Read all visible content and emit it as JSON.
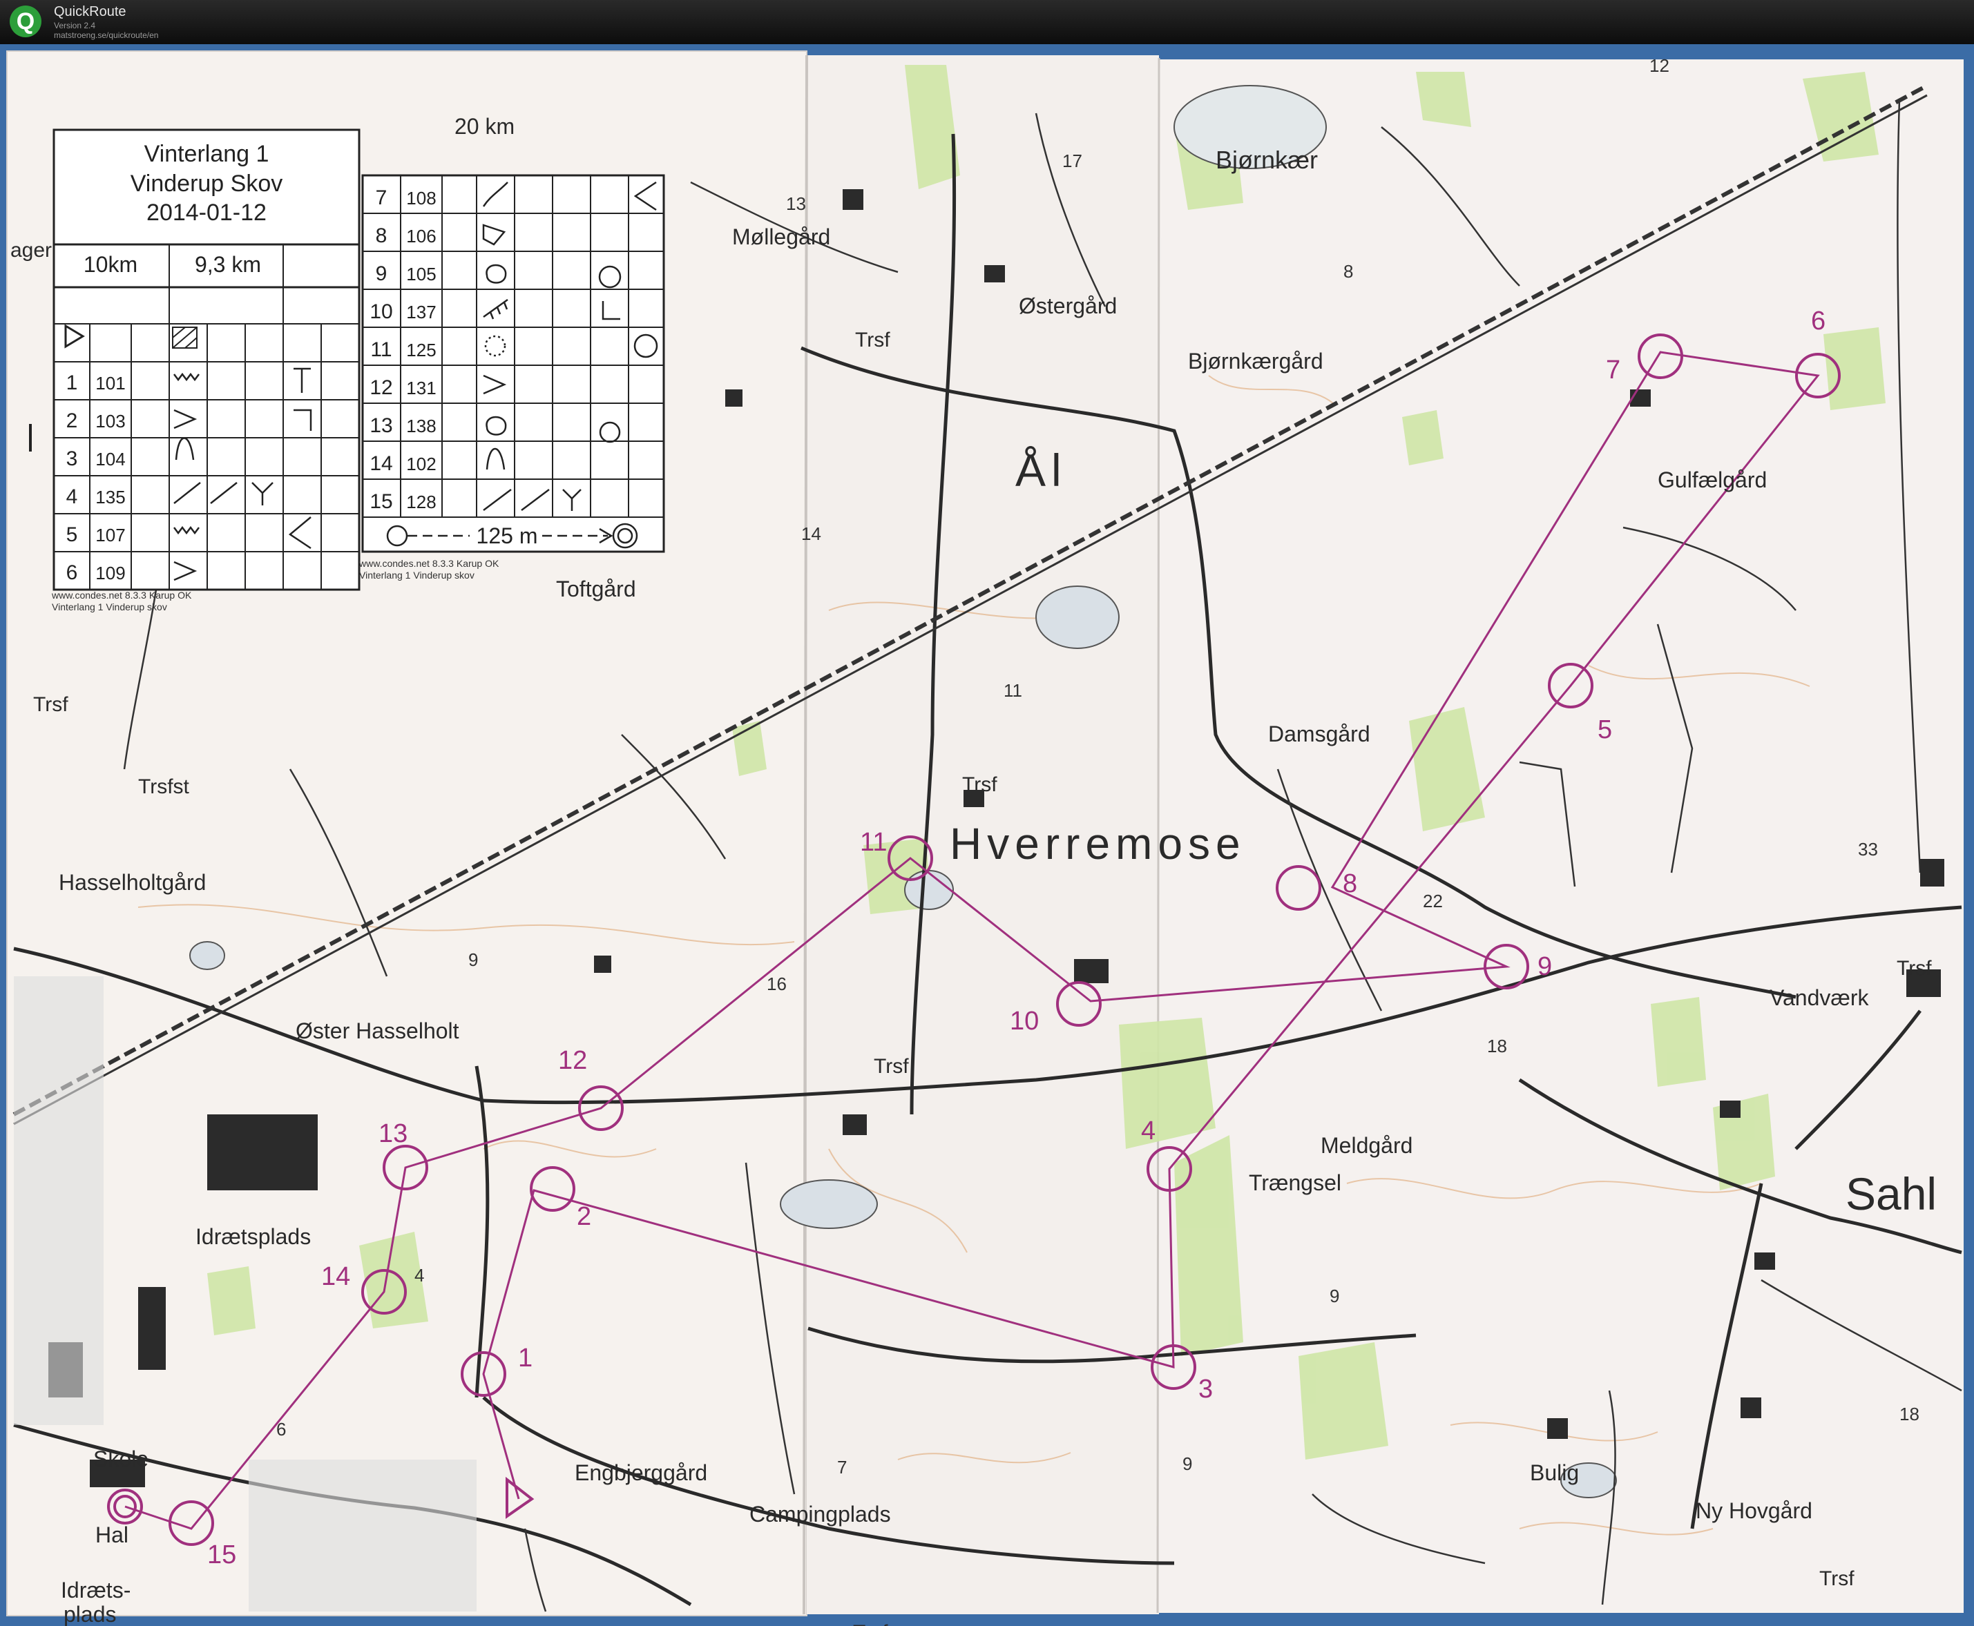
{
  "app": {
    "title": "QuickRoute",
    "version": "Version 2.4",
    "url": "matstroeng.se/quickroute/en"
  },
  "colors": {
    "course": "#a0307e",
    "road": "#222222",
    "paper": "#f7f3ee",
    "field": "#cfe5a8",
    "contour": "#d89a5a",
    "frame": "#3b6ca6"
  },
  "legend": {
    "title_line1": "Vinterlang 1",
    "title_line2": "Vinderup Skov",
    "date": "2014-01-12",
    "course_a": "10km",
    "course_b": "9,3 km",
    "rows_left": [
      {
        "num": "1",
        "code": "101"
      },
      {
        "num": "2",
        "code": "103"
      },
      {
        "num": "3",
        "code": "104"
      },
      {
        "num": "4",
        "code": "135"
      },
      {
        "num": "5",
        "code": "107"
      },
      {
        "num": "6",
        "code": "109"
      }
    ],
    "rows_right": [
      {
        "num": "7",
        "code": "108"
      },
      {
        "num": "8",
        "code": "106"
      },
      {
        "num": "9",
        "code": "105"
      },
      {
        "num": "10",
        "code": "137"
      },
      {
        "num": "11",
        "code": "125"
      },
      {
        "num": "12",
        "code": "131"
      },
      {
        "num": "13",
        "code": "138"
      },
      {
        "num": "14",
        "code": "102"
      },
      {
        "num": "15",
        "code": "128"
      }
    ],
    "finish_text": "125 m",
    "credit_1": "www.condes.net 8.3.3 Karup OK",
    "credit_2": "Vinterlang 1 Vinderup skov"
  },
  "controls": [
    {
      "label": "1"
    },
    {
      "label": "2"
    },
    {
      "label": "3"
    },
    {
      "label": "4"
    },
    {
      "label": "5"
    },
    {
      "label": "6"
    },
    {
      "label": "7"
    },
    {
      "label": "8"
    },
    {
      "label": "9"
    },
    {
      "label": "10"
    },
    {
      "label": "11"
    },
    {
      "label": "12"
    },
    {
      "label": "13"
    },
    {
      "label": "14"
    },
    {
      "label": "15"
    }
  ],
  "place_names": {
    "hverremose": "Hverremose",
    "aal": "Ål",
    "sahl": "Sahl",
    "bjornkaer": "Bjørnkær",
    "bjornkaergaard": "Bjørnkærgård",
    "mollegaard": "Møllegård",
    "ostergaard": "Østergård",
    "toftgaard": "Toftgård",
    "gulfaelgaard": "Gulfælgård",
    "damsgaard": "Damsgård",
    "hasselholtgaard": "Hasselholtgård",
    "oster_hasselholt": "Øster Hasselholt",
    "idraetsplads": "Idrætsplads",
    "idraets": "Idræts-",
    "plads": "plads",
    "skole": "Skole",
    "hal": "Hal",
    "engbjerggaard": "Engbjerggård",
    "campingplads": "Campingplads",
    "traengsel": "Trængsel",
    "meldgaard": "Meldgård",
    "vandvaerk": "Vandværk",
    "bulig": "Bulig",
    "ny_hovgaard": "Ny Hovgård",
    "trsf": "Trsf",
    "trsfst": "Trsfst",
    "twenty_km": "20 km",
    "ager": "ager"
  },
  "map_numbers": [
    "17",
    "13",
    "8",
    "11",
    "14",
    "16",
    "9",
    "22",
    "18",
    "33",
    "9",
    "18",
    "4",
    "6",
    "7",
    "9",
    "12"
  ]
}
